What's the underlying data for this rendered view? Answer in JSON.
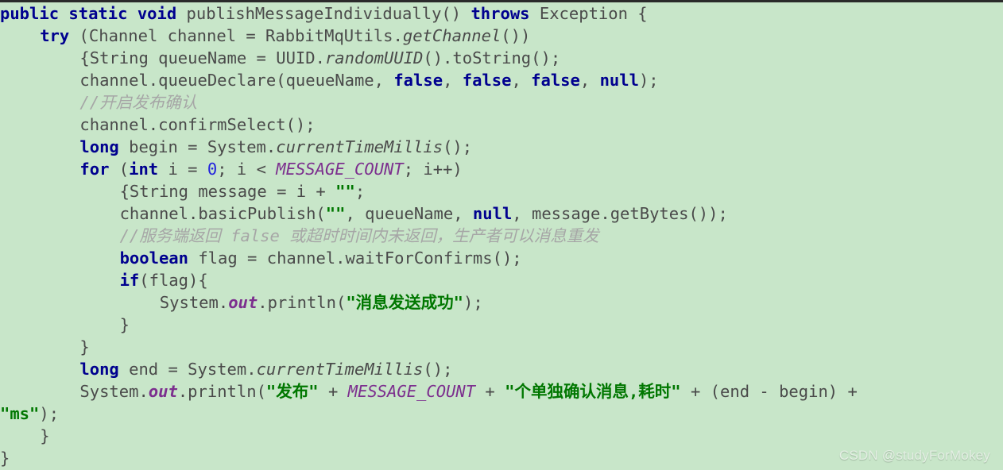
{
  "editor": {
    "language": "java",
    "background_color": "#c8e6c9",
    "colors": {
      "keyword": "#00008f",
      "string": "#007700",
      "comment": "#a6a6a6",
      "number": "#2222dd",
      "field": "#7c2f8e",
      "constant": "#7c2f8e",
      "plain": "#4a4a4a"
    },
    "lines": [
      {
        "id": "l1",
        "indent": 0,
        "tokens": [
          {
            "t": "public",
            "c": "kw"
          },
          {
            "t": " ",
            "c": "plain"
          },
          {
            "t": "static",
            "c": "kw"
          },
          {
            "t": " ",
            "c": "plain"
          },
          {
            "t": "void",
            "c": "kw"
          },
          {
            "t": " publishMessageIndividually() ",
            "c": "plain"
          },
          {
            "t": "throws",
            "c": "kw"
          },
          {
            "t": " Exception {",
            "c": "plain"
          }
        ]
      },
      {
        "id": "l2",
        "indent": 4,
        "tokens": [
          {
            "t": "try",
            "c": "kw"
          },
          {
            "t": " (Channel channel = RabbitMqUtils.",
            "c": "plain"
          },
          {
            "t": "getChannel",
            "c": "meth"
          },
          {
            "t": "())",
            "c": "plain"
          }
        ]
      },
      {
        "id": "l3",
        "indent": 8,
        "tokens": [
          {
            "t": "{String queueName = UUID.",
            "c": "plain"
          },
          {
            "t": "randomUUID",
            "c": "meth"
          },
          {
            "t": "().toString();",
            "c": "plain"
          }
        ]
      },
      {
        "id": "l4",
        "indent": 8,
        "tokens": [
          {
            "t": "channel.queueDeclare(queueName, ",
            "c": "plain"
          },
          {
            "t": "false",
            "c": "kw"
          },
          {
            "t": ", ",
            "c": "plain"
          },
          {
            "t": "false",
            "c": "kw"
          },
          {
            "t": ", ",
            "c": "plain"
          },
          {
            "t": "false",
            "c": "kw"
          },
          {
            "t": ", ",
            "c": "plain"
          },
          {
            "t": "null",
            "c": "kw"
          },
          {
            "t": ");",
            "c": "plain"
          }
        ]
      },
      {
        "id": "l5",
        "indent": 8,
        "tokens": [
          {
            "t": "//开启发布确认",
            "c": "cmt"
          }
        ]
      },
      {
        "id": "l6",
        "indent": 8,
        "tokens": [
          {
            "t": "channel.confirmSelect();",
            "c": "plain"
          }
        ]
      },
      {
        "id": "l7",
        "indent": 8,
        "tokens": [
          {
            "t": "long",
            "c": "kw"
          },
          {
            "t": " begin = System.",
            "c": "plain"
          },
          {
            "t": "currentTimeMillis",
            "c": "meth"
          },
          {
            "t": "();",
            "c": "plain"
          }
        ]
      },
      {
        "id": "l8",
        "indent": 8,
        "tokens": [
          {
            "t": "for",
            "c": "kw"
          },
          {
            "t": " (",
            "c": "plain"
          },
          {
            "t": "int",
            "c": "kw"
          },
          {
            "t": " i = ",
            "c": "plain"
          },
          {
            "t": "0",
            "c": "num"
          },
          {
            "t": "; i < ",
            "c": "plain"
          },
          {
            "t": "MESSAGE_COUNT",
            "c": "const"
          },
          {
            "t": "; i++)",
            "c": "plain"
          }
        ]
      },
      {
        "id": "l9",
        "indent": 12,
        "tokens": [
          {
            "t": "{String message = i + ",
            "c": "plain"
          },
          {
            "t": "\"\"",
            "c": "str"
          },
          {
            "t": ";",
            "c": "plain"
          }
        ]
      },
      {
        "id": "l10",
        "indent": 12,
        "tokens": [
          {
            "t": "channel.basicPublish(",
            "c": "plain"
          },
          {
            "t": "\"\"",
            "c": "str"
          },
          {
            "t": ", queueName, ",
            "c": "plain"
          },
          {
            "t": "null",
            "c": "kw"
          },
          {
            "t": ", message.getBytes());",
            "c": "plain"
          }
        ]
      },
      {
        "id": "l11",
        "indent": 12,
        "tokens": [
          {
            "t": "//服务端返回 false 或超时时间内未返回，生产者可以消息重发",
            "c": "cmt"
          }
        ]
      },
      {
        "id": "l12",
        "indent": 12,
        "tokens": [
          {
            "t": "boolean",
            "c": "kw"
          },
          {
            "t": " flag = channel.waitForConfirms();",
            "c": "plain"
          }
        ]
      },
      {
        "id": "l13",
        "indent": 12,
        "tokens": [
          {
            "t": "if",
            "c": "kw"
          },
          {
            "t": "(flag){",
            "c": "plain"
          }
        ]
      },
      {
        "id": "l14",
        "indent": 16,
        "tokens": [
          {
            "t": "System.",
            "c": "plain"
          },
          {
            "t": "out",
            "c": "field"
          },
          {
            "t": ".println(",
            "c": "plain"
          },
          {
            "t": "\"消息发送成功\"",
            "c": "str"
          },
          {
            "t": ");",
            "c": "plain"
          }
        ]
      },
      {
        "id": "l15",
        "indent": 12,
        "tokens": [
          {
            "t": "}",
            "c": "plain"
          }
        ]
      },
      {
        "id": "l16",
        "indent": 8,
        "tokens": [
          {
            "t": "}",
            "c": "plain"
          }
        ]
      },
      {
        "id": "l17",
        "indent": 8,
        "tokens": [
          {
            "t": "long",
            "c": "kw"
          },
          {
            "t": " end = System.",
            "c": "plain"
          },
          {
            "t": "currentTimeMillis",
            "c": "meth"
          },
          {
            "t": "();",
            "c": "plain"
          }
        ]
      },
      {
        "id": "l18",
        "indent": 8,
        "tokens": [
          {
            "t": "System.",
            "c": "plain"
          },
          {
            "t": "out",
            "c": "field"
          },
          {
            "t": ".println(",
            "c": "plain"
          },
          {
            "t": "\"发布\"",
            "c": "str"
          },
          {
            "t": " + ",
            "c": "plain"
          },
          {
            "t": "MESSAGE_COUNT",
            "c": "const"
          },
          {
            "t": " + ",
            "c": "plain"
          },
          {
            "t": "\"个单独确认消息,耗时\"",
            "c": "str"
          },
          {
            "t": " + (end - begin) + ",
            "c": "plain"
          }
        ]
      },
      {
        "id": "l19",
        "indent": 0,
        "tokens": [
          {
            "t": "\"ms\"",
            "c": "str"
          },
          {
            "t": ");",
            "c": "plain"
          }
        ]
      },
      {
        "id": "l20",
        "indent": 4,
        "tokens": [
          {
            "t": "}",
            "c": "plain"
          }
        ]
      },
      {
        "id": "l21",
        "indent": 0,
        "tokens": [
          {
            "t": "}",
            "c": "plain"
          }
        ]
      }
    ]
  },
  "watermark": {
    "text": "CSDN @studyForMokey"
  }
}
